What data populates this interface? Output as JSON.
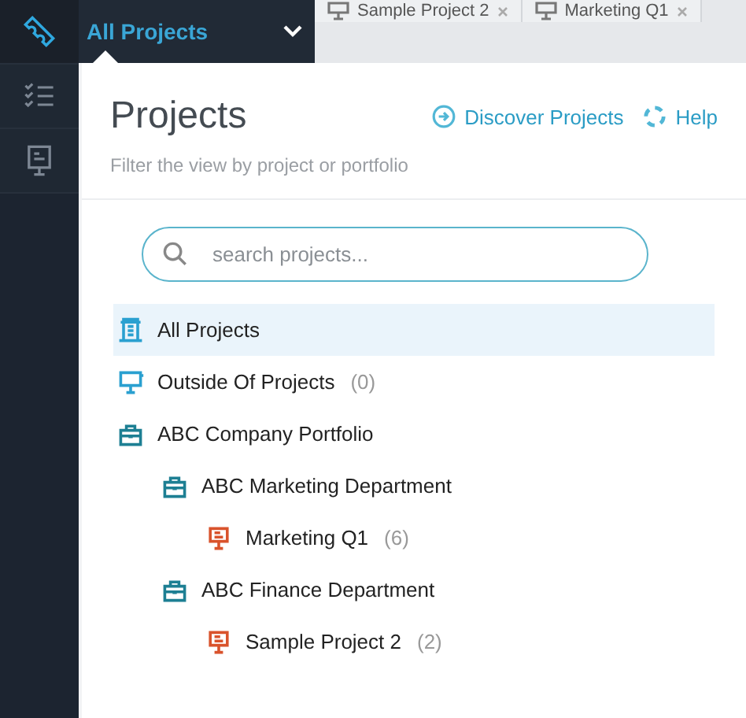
{
  "rail": [
    {
      "kind": "ticket",
      "selected": true
    },
    {
      "kind": "checklist",
      "selected": false
    },
    {
      "kind": "board",
      "selected": false
    }
  ],
  "header": {
    "title": "All Projects"
  },
  "tabs": [
    {
      "label": "Sample Project 2"
    },
    {
      "label": "Marketing Q1"
    }
  ],
  "panel": {
    "title": "Projects",
    "subtitle": "Filter the view by project or portfolio",
    "links": [
      {
        "kind": "discover",
        "label": "Discover Projects"
      },
      {
        "kind": "help",
        "label": "Help"
      }
    ],
    "search": {
      "placeholder": "search projects..."
    },
    "tree": [
      {
        "kind": "all",
        "label": "All Projects",
        "selected": true
      },
      {
        "kind": "outside",
        "label": "Outside Of Projects",
        "count": "(0)",
        "selected": false
      },
      {
        "kind": "portfolio",
        "label": "ABC Company Portfolio",
        "selected": false,
        "children": [
          {
            "kind": "portfolio",
            "label": "ABC Marketing Department",
            "selected": false,
            "children": [
              {
                "kind": "project",
                "label": "Marketing Q1",
                "count": "(6)",
                "selected": false
              }
            ]
          },
          {
            "kind": "portfolio",
            "label": "ABC Finance Department",
            "selected": false,
            "children": [
              {
                "kind": "project",
                "label": "Sample Project 2",
                "count": "(2)",
                "selected": false
              }
            ]
          }
        ]
      }
    ]
  }
}
